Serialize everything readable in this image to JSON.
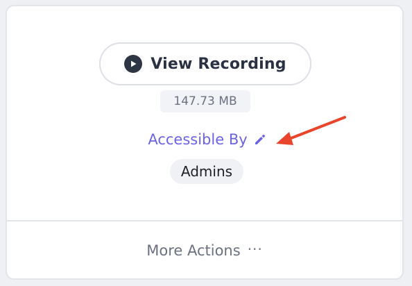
{
  "recording": {
    "view_label": "View Recording",
    "file_size": "147.73 MB"
  },
  "access": {
    "label": "Accessible By",
    "roles": [
      "Admins"
    ]
  },
  "footer": {
    "more_actions_label": "More Actions",
    "more_icon_glyph": "···"
  },
  "icons": {
    "play": "play-circle-icon",
    "edit": "pencil-icon",
    "more": "more-dots-icon",
    "annotation": "red-arrow-annotation"
  },
  "colors": {
    "accent": "#6a63e6",
    "annotation_arrow": "#e8452c",
    "button_text": "#2a3142",
    "muted_text": "#6b7180"
  }
}
